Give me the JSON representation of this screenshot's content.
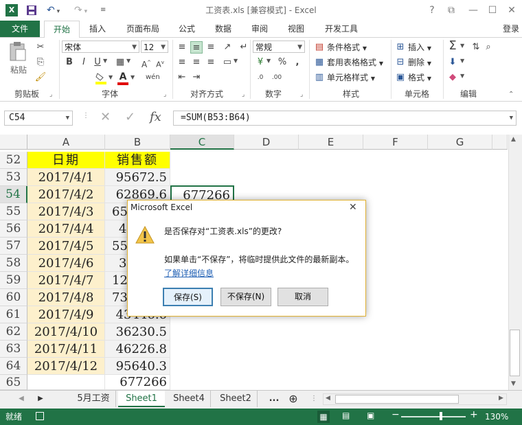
{
  "window": {
    "title": "工资表.xls  [兼容模式] - Excel",
    "help": "?",
    "login": "登录"
  },
  "tabs": [
    "文件",
    "开始",
    "插入",
    "页面布局",
    "公式",
    "数据",
    "审阅",
    "视图",
    "开发工具"
  ],
  "ribbon": {
    "clipboard": {
      "paste": "粘贴",
      "label": "剪贴板"
    },
    "font": {
      "name": "宋体",
      "size": "12",
      "label": "字体",
      "bold": "B",
      "italic": "I",
      "underline": "U",
      "font_color_letter": "A"
    },
    "alignment": {
      "label": "对齐方式"
    },
    "number": {
      "format": "常规",
      "percent": "%",
      "comma": ",",
      "label": "数字"
    },
    "styles": {
      "conditional": "条件格式",
      "table": "套用表格格式",
      "cell": "单元格样式",
      "label": "样式"
    },
    "cells": {
      "insert": "插入",
      "delete": "删除",
      "format": "格式",
      "label": "单元格"
    },
    "editing": {
      "label": "编辑"
    }
  },
  "formula_bar": {
    "name_box": "C54",
    "formula": "=SUM(B53:B64)",
    "fx": "fx"
  },
  "columns": [
    "A",
    "B",
    "C",
    "D",
    "E",
    "F",
    "G"
  ],
  "header_row": {
    "row": "52",
    "a": "日期",
    "b": "销售额"
  },
  "rows": [
    {
      "row": "53",
      "a": "2017/4/1",
      "b": "95672.5",
      "c": ""
    },
    {
      "row": "54",
      "a": "2017/4/2",
      "b": "62869.6",
      "c": "677266"
    },
    {
      "row": "55",
      "a": "2017/4/3",
      "b": "65",
      "c": ""
    },
    {
      "row": "56",
      "a": "2017/4/4",
      "b": "4",
      "c": ""
    },
    {
      "row": "57",
      "a": "2017/4/5",
      "b": "55",
      "c": ""
    },
    {
      "row": "58",
      "a": "2017/4/6",
      "b": "3",
      "c": ""
    },
    {
      "row": "59",
      "a": "2017/4/7",
      "b": "12",
      "c": ""
    },
    {
      "row": "60",
      "a": "2017/4/8",
      "b": "73",
      "c": ""
    },
    {
      "row": "61",
      "a": "2017/4/9",
      "b": "43446.6",
      "c": ""
    },
    {
      "row": "62",
      "a": "2017/4/10",
      "b": "36230.5",
      "c": ""
    },
    {
      "row": "63",
      "a": "2017/4/11",
      "b": "46226.8",
      "c": ""
    },
    {
      "row": "64",
      "a": "2017/4/12",
      "b": "95640.3",
      "c": ""
    }
  ],
  "total_row": {
    "row": "65",
    "b": "677266"
  },
  "sheets": [
    "5月工资",
    "Sheet1",
    "Sheet4",
    "Sheet2"
  ],
  "sheet_more": "...",
  "status": {
    "ready": "就绪",
    "zoom": "130%"
  },
  "dialog": {
    "title": "Microsoft Excel",
    "message": "是否保存对“工资表.xls”的更改?",
    "detail": "如果单击“不保存”，将临时提供此文件的最新副本。",
    "link": "了解详细信息",
    "save": "保存(S)",
    "dont_save": "不保存(N)",
    "cancel": "取消"
  },
  "colors": {
    "accent": "#217346",
    "header_fill": "#ffff00",
    "date_fill": "#fdf0cc",
    "sales_fill": "#f2f2f2"
  }
}
